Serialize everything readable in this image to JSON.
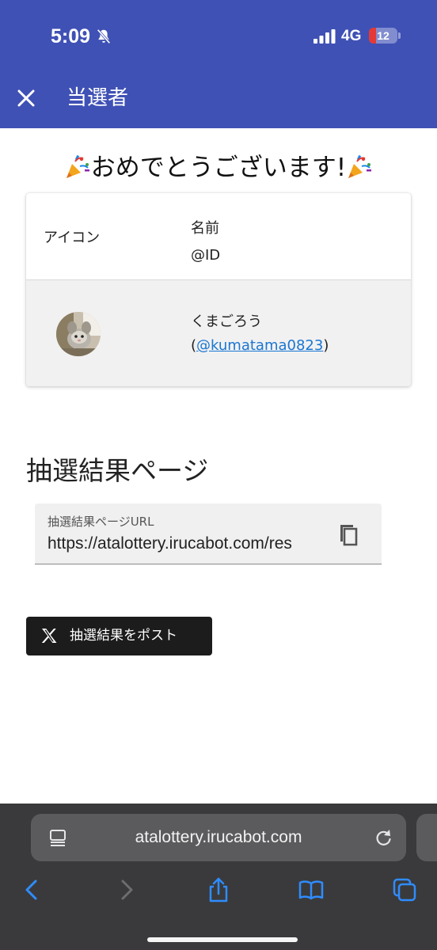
{
  "status_bar": {
    "time": "5:09",
    "network": "4G",
    "battery": "12"
  },
  "header": {
    "title": "当選者"
  },
  "congrats": {
    "text": "おめでとうございます!"
  },
  "winner_table": {
    "col_icon_header": "アイコン",
    "col_name_header": "名前",
    "col_id_header": "@ID",
    "rows": [
      {
        "name": "くまごろう",
        "id_open": "(",
        "id": "@kumatama0823",
        "id_close": ")"
      }
    ]
  },
  "result_page": {
    "section_title": "抽選結果ページ",
    "url_label": "抽選結果ページURL",
    "url_value": "https://atalottery.irucabot.com/res"
  },
  "post_button": {
    "label": "抽選結果をポスト"
  },
  "browser": {
    "address": "atalottery.irucabot.com"
  },
  "colors": {
    "header": "#3f51b5",
    "link": "#1976d2",
    "post_button": "#1c1c1c",
    "browser_icons": "#2f8cff"
  }
}
